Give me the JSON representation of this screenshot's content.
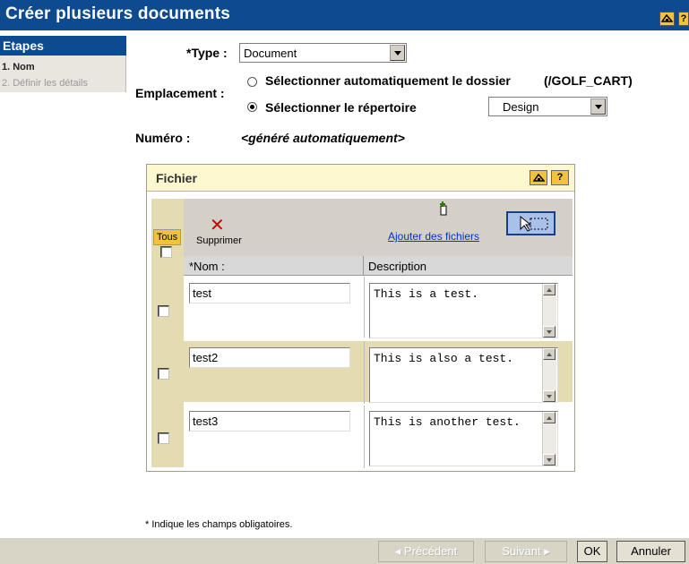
{
  "title": "Créer plusieurs documents",
  "title_buttons": {
    "help_icon": "help-icon",
    "question": "?"
  },
  "sidebar": {
    "heading": "Etapes",
    "steps": [
      {
        "label": "1. Nom",
        "active": true
      },
      {
        "label": "2. Définir les détails",
        "active": false
      }
    ]
  },
  "form": {
    "type_label": "*Type :",
    "type_value": "Document",
    "location_label": "Emplacement :",
    "radio_auto": "Sélectionner automatiquement le dossier",
    "auto_folder": "(/GOLF_CART)",
    "radio_choose": "Sélectionner le répertoire",
    "folder_value": "Design",
    "number_label": "Numéro :",
    "number_value": "<généré automatiquement>"
  },
  "panel": {
    "title": "Fichier",
    "question": "?",
    "all_label": "Tous",
    "delete_label": "Supprimer",
    "add_label": "Ajouter des fichiers",
    "col_name": "*Nom :",
    "col_desc": "Description",
    "rows": [
      {
        "name": "test",
        "description": "This is a test."
      },
      {
        "name": "test2",
        "description": "This is also a test."
      },
      {
        "name": "test3",
        "description": "This is another test."
      }
    ]
  },
  "required_note": "* Indique les champs obligatoires.",
  "footer": {
    "prev": "◂ Précédent",
    "next": "Suivant ▸",
    "ok": "OK",
    "cancel": "Annuler"
  },
  "colors": {
    "title_bg": "#0d4a8f",
    "accent_yellow": "#f1c33b",
    "panel_head": "#fef8d0",
    "row_alt": "#e4dbb0",
    "link": "#0033cc",
    "delete_red": "#cc0000"
  }
}
